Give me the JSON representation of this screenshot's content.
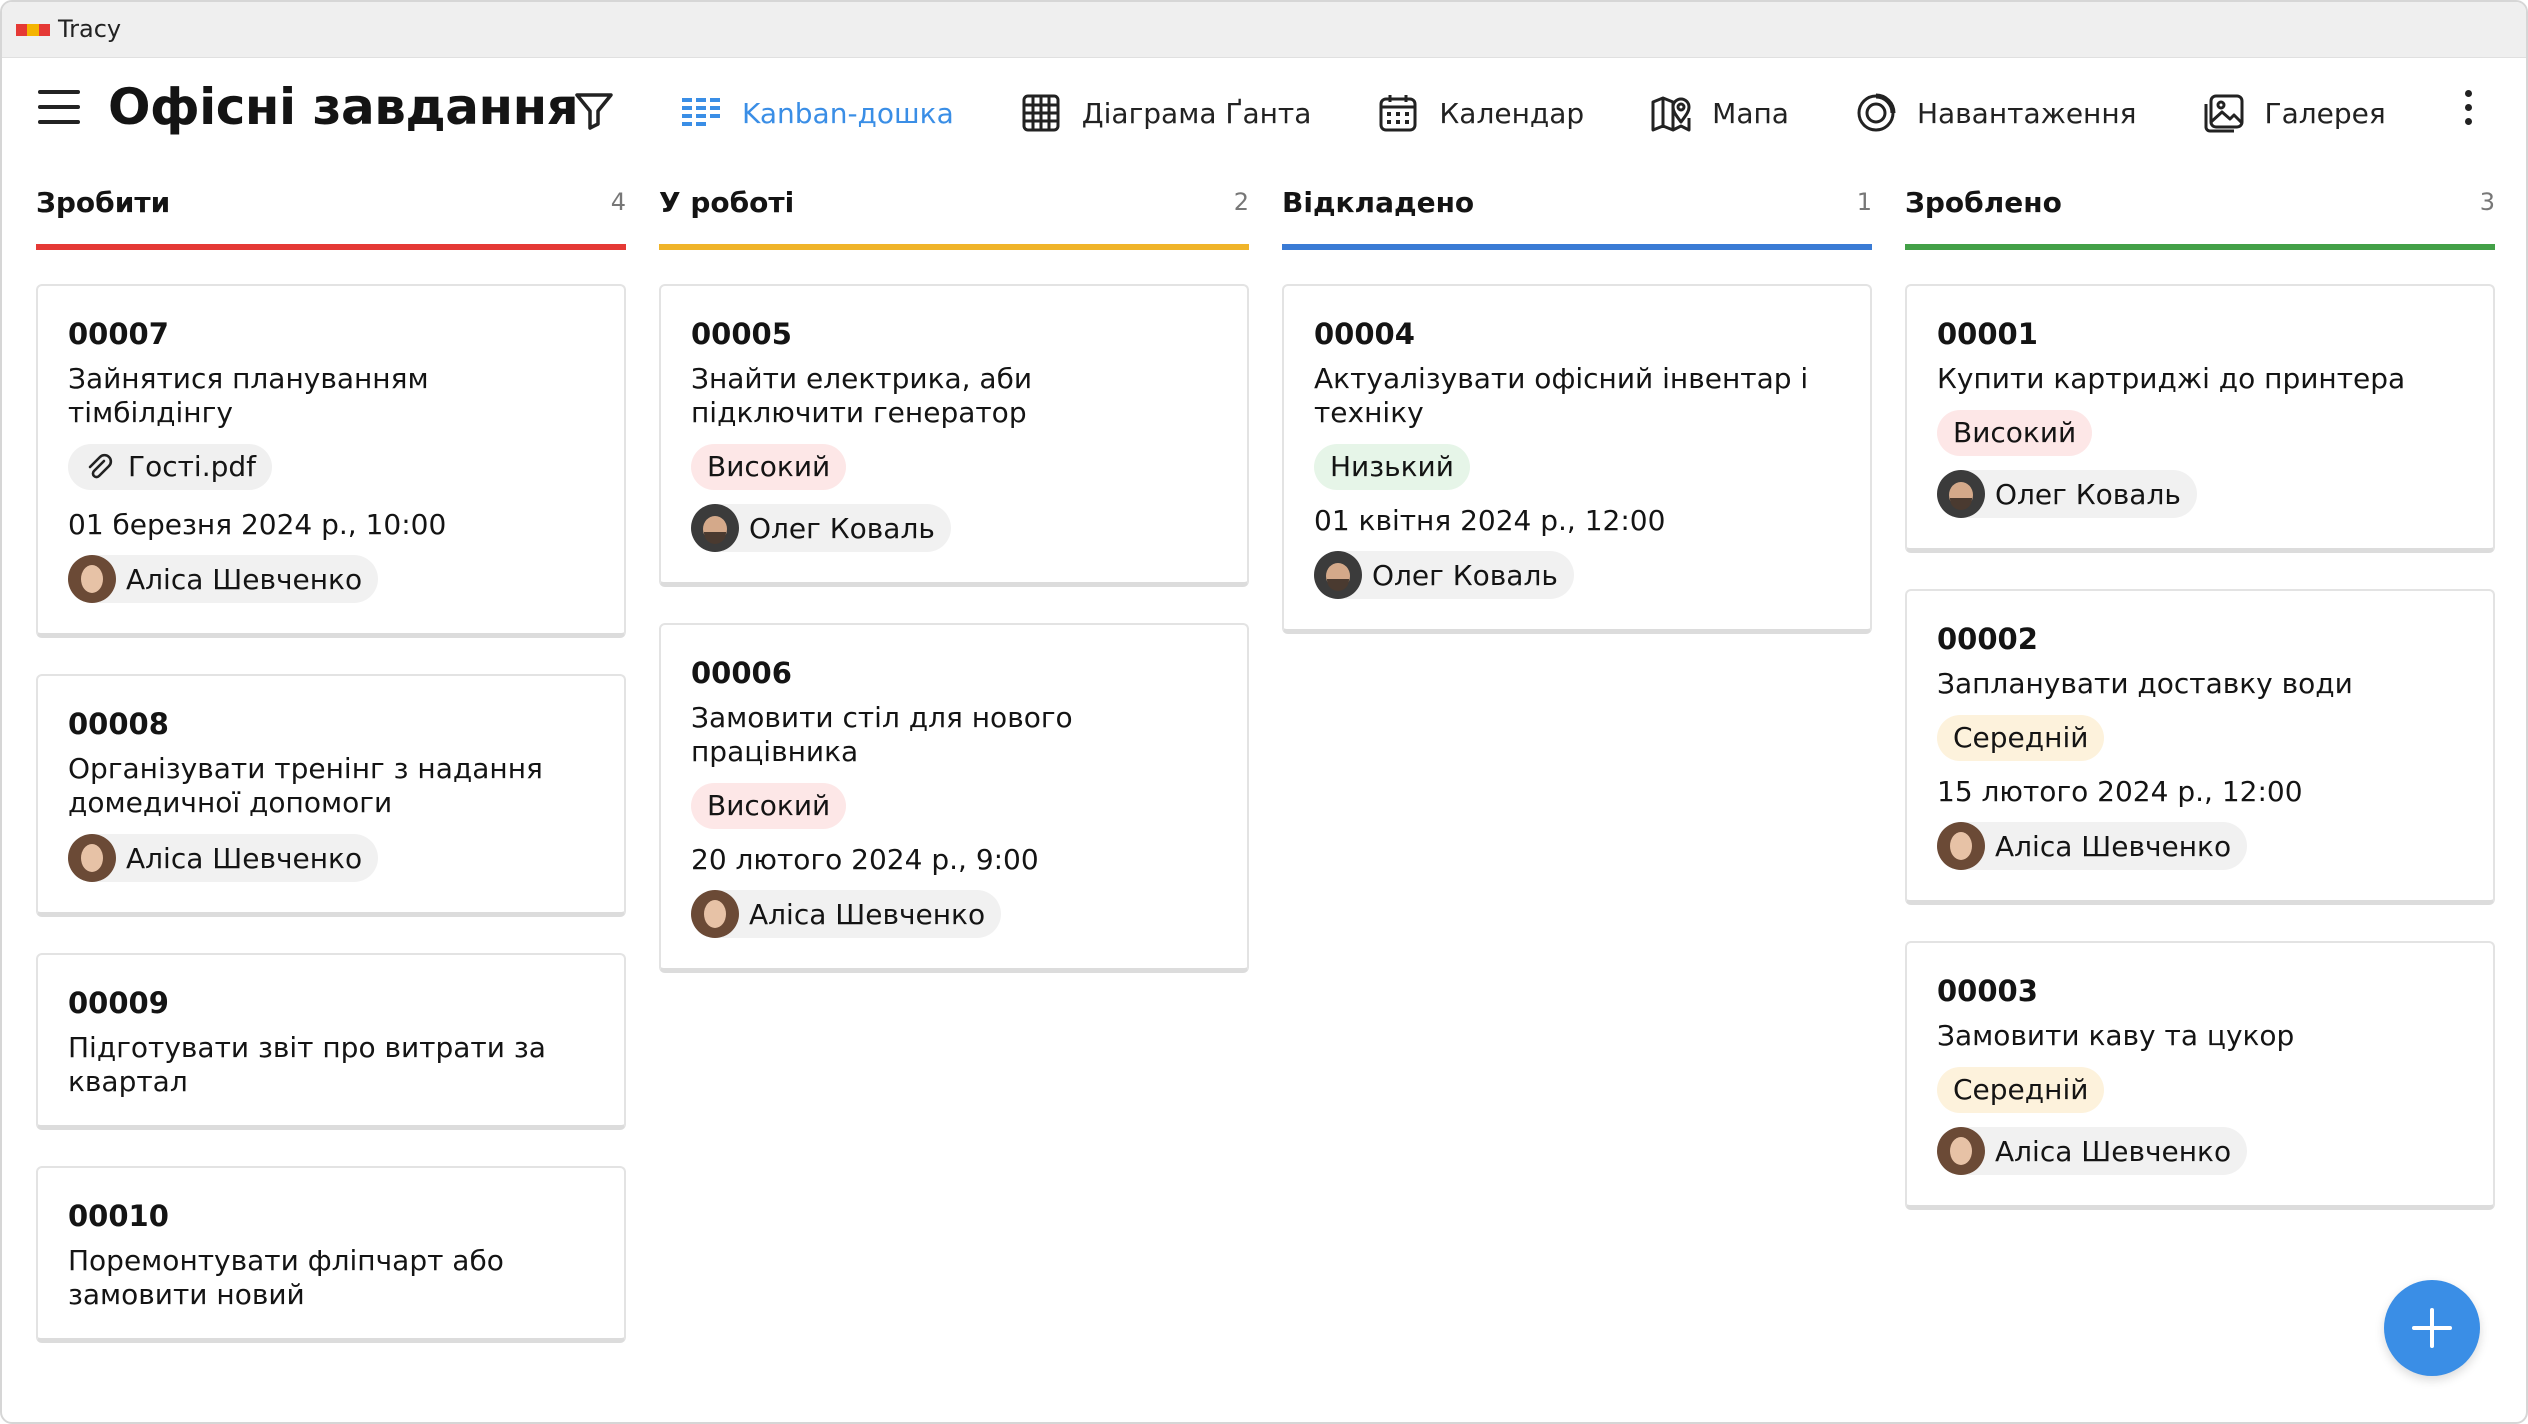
{
  "window": {
    "title": "Tracy",
    "logo_colors": [
      "#e53935",
      "#f4b400",
      "#e53935"
    ]
  },
  "toolbar": {
    "title": "Офісні завдання",
    "views": [
      {
        "label": "Kanban-дошка",
        "icon": "kanban-icon",
        "active": true
      },
      {
        "label": "Діаграма Ґанта",
        "icon": "grid-icon",
        "active": false
      },
      {
        "label": "Календар",
        "icon": "calendar-icon",
        "active": false
      },
      {
        "label": "Мапа",
        "icon": "map-icon",
        "active": false
      },
      {
        "label": "Навантаження",
        "icon": "workload-icon",
        "active": false
      },
      {
        "label": "Галерея",
        "icon": "gallery-icon",
        "active": false
      }
    ]
  },
  "colors": {
    "accent": "#3a8ee6",
    "todo": "#e53935",
    "in_progress": "#f0b429",
    "postponed": "#3a7bd5",
    "done": "#43a047"
  },
  "columns": [
    {
      "name": "Зробити",
      "count": "4",
      "cards": [
        {
          "id": "00007",
          "title": "Зайнятися плануванням тімбілдінгу",
          "attachment": "Гості.pdf",
          "date": "01 березня 2024 р., 10:00",
          "assignee": "Аліса Шевченко"
        },
        {
          "id": "00008",
          "title": "Організувати тренінг з надання домедичної допомоги",
          "assignee": "Аліса Шевченко"
        },
        {
          "id": "00009",
          "title": "Підготувати звіт про витрати за квартал"
        },
        {
          "id": "00010",
          "title": "Поремонтувати фліпчарт або замовити новий"
        }
      ]
    },
    {
      "name": "У роботі",
      "count": "2",
      "cards": [
        {
          "id": "00005",
          "title": "Знайти електрика, аби підключити генератор",
          "priority": "Високий",
          "assignee": "Олег Коваль"
        },
        {
          "id": "00006",
          "title": "Замовити стіл для нового працівника",
          "priority": "Високий",
          "date": "20 лютого 2024 р., 9:00",
          "assignee": "Аліса Шевченко"
        }
      ]
    },
    {
      "name": "Відкладено",
      "count": "1",
      "cards": [
        {
          "id": "00004",
          "title": "Актуалізувати офісний інвентар і техніку",
          "priority": "Низький",
          "date": "01 квітня 2024 р., 12:00",
          "assignee": "Олег Коваль"
        }
      ]
    },
    {
      "name": "Зроблено",
      "count": "3",
      "cards": [
        {
          "id": "00001",
          "title": "Купити картриджі до принтера",
          "priority": "Високий",
          "assignee": "Олег Коваль"
        },
        {
          "id": "00002",
          "title": "Запланувати доставку води",
          "priority": "Середній",
          "date": "15 лютого 2024 р., 12:00",
          "assignee": "Аліса Шевченко"
        },
        {
          "id": "00003",
          "title": "Замовити каву та цукор",
          "priority": "Середній",
          "assignee": "Аліса Шевченко"
        }
      ]
    }
  ]
}
